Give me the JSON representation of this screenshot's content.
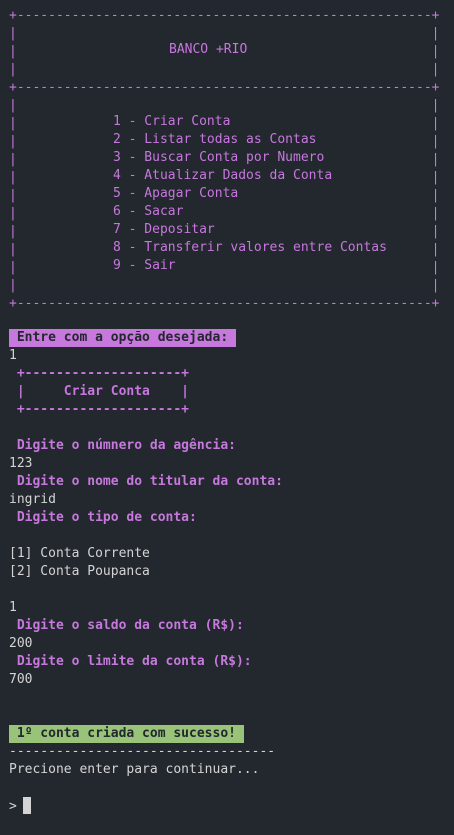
{
  "banner": {
    "border": "+-----------------------------------------------------+",
    "side": "|                                                     |",
    "title": "BANCO +RIO"
  },
  "menu": [
    "1 - Criar Conta",
    "2 - Listar todas as Contas",
    "3 - Buscar Conta por Numero",
    "4 - Atualizar Dados da Conta",
    "5 - Apagar Conta",
    "6 - Sacar",
    "7 - Depositar",
    "8 - Transferir valores entre Contas",
    "9 - Sair"
  ],
  "prompt_option": " Entre com a opção desejada: ",
  "input_option": "1",
  "section": {
    "border": " +--------------------+",
    "title": " |     Criar Conta    |"
  },
  "fields": {
    "agency_prompt": " Digite o númnero da agência:",
    "agency_value": "123",
    "holder_prompt": " Digite o nome do titular da conta:",
    "holder_value": "ingrid",
    "type_prompt": " Digite o tipo de conta:",
    "type_option_1": "[1] Conta Corrente",
    "type_option_2": "[2] Conta Poupanca",
    "type_value": "1",
    "balance_prompt": " Digite o saldo da conta (R$):",
    "balance_value": "200",
    "limit_prompt": " Digite o limite da conta (R$):",
    "limit_value": "700"
  },
  "success_message": " 1º conta criada com sucesso! ",
  "divider": "----------------------------------",
  "continue_prompt": "Precione enter para continuar...",
  "shell_prompt": ">",
  "colors": {
    "background": "#23272e",
    "text": "#d4d4d4",
    "accent_magenta": "#c678dd",
    "success_green": "#98c379"
  }
}
